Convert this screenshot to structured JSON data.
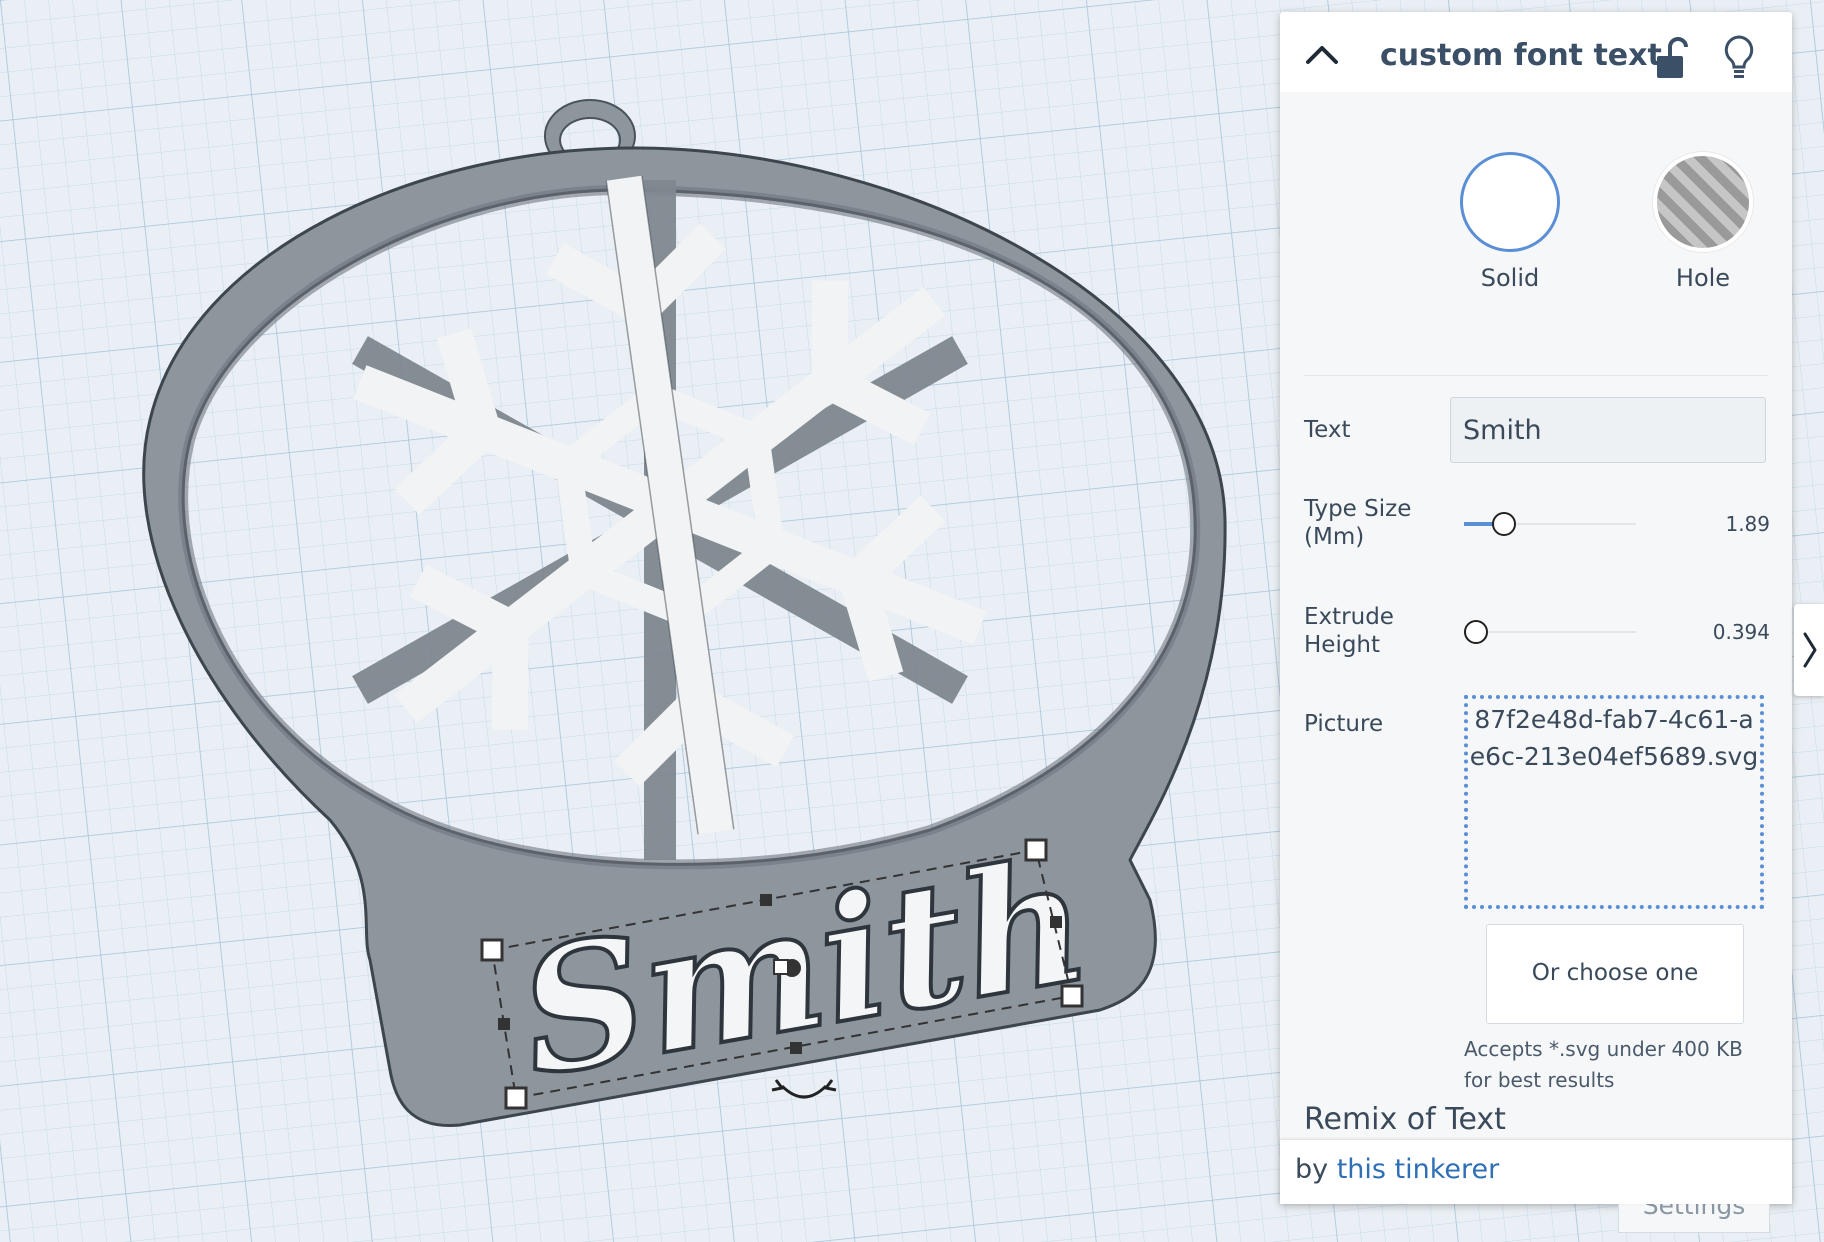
{
  "workplane": {
    "object_text": "Smith",
    "colors": {
      "grid_bg": "#e9eff4",
      "ornament": "#8d959d",
      "snowflake": "#f2f3f4",
      "text_fill": "#f4f5f6"
    }
  },
  "inspector": {
    "title": "custom font text",
    "header_icons": [
      "chevron-up-icon",
      "unlock-icon",
      "lightbulb-icon"
    ],
    "shape_options": [
      {
        "label": "Solid",
        "selected": true
      },
      {
        "label": "Hole",
        "selected": false
      }
    ],
    "properties": {
      "text_label": "Text",
      "text_value": "Smith",
      "type_size_label_line1": "Type Size",
      "type_size_label_line2": "(Mm)",
      "type_size_value": "1.89",
      "type_size_fraction": 0.19,
      "extrude_label_line1": "Extrude",
      "extrude_label_line2": "Height",
      "extrude_value": "0.394",
      "extrude_fraction": 0.0,
      "picture_label": "Picture",
      "picture_filename": "87f2e48d-fab7-4c61-ae6c-213e04ef5689.svg",
      "choose_button": "Or choose one",
      "accepts_note": "Accepts *.svg under 400 KB for best results"
    },
    "remix_title": "Remix of Text",
    "footer_by": "by ",
    "footer_author": "this tinkerer",
    "accent_color": "#5a8fd6"
  },
  "settings_label": "Settings"
}
